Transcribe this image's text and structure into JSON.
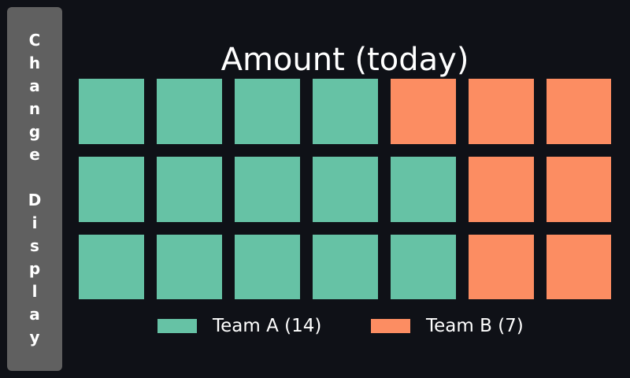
{
  "side_button": {
    "label": "Change Display"
  },
  "colors": {
    "background": "#0f1117",
    "button": "#606060",
    "team_a": "#66c2a5",
    "team_b": "#fc8d62",
    "text": "#ffffff"
  },
  "chart_data": {
    "type": "waffle",
    "title": "Amount (today)",
    "rows": 3,
    "columns": 7,
    "grid": [
      [
        "Team A",
        "Team A",
        "Team A",
        "Team A",
        "Team B",
        "Team B",
        "Team B"
      ],
      [
        "Team A",
        "Team A",
        "Team A",
        "Team A",
        "Team A",
        "Team B",
        "Team B"
      ],
      [
        "Team A",
        "Team A",
        "Team A",
        "Team A",
        "Team A",
        "Team B",
        "Team B"
      ]
    ],
    "series": [
      {
        "name": "Team A",
        "value": 14,
        "color": "#66c2a5",
        "legend": "Team A (14)"
      },
      {
        "name": "Team B",
        "value": 7,
        "color": "#fc8d62",
        "legend": "Team B (7)"
      }
    ],
    "legend_position": "bottom"
  }
}
